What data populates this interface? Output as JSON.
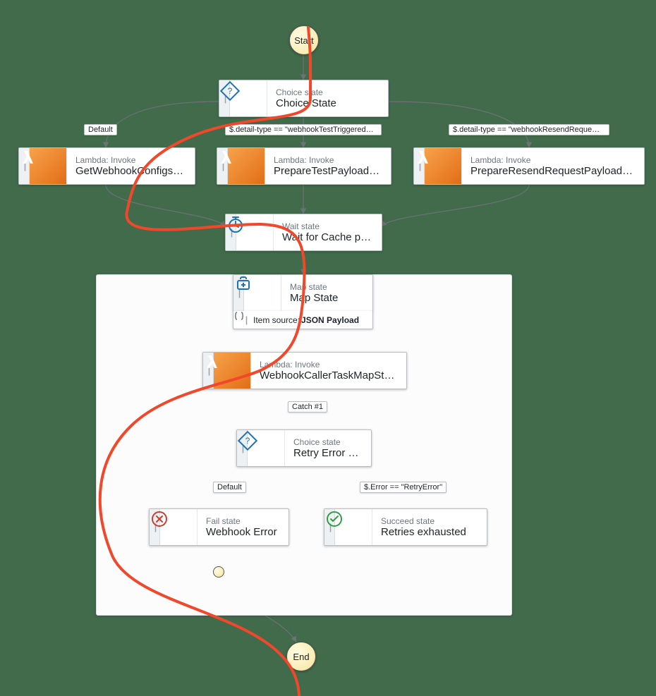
{
  "start": {
    "label": "Start"
  },
  "end": {
    "label": "End"
  },
  "choice_state": {
    "kicker": "Choice state",
    "title": "Choice State"
  },
  "get_configs": {
    "kicker": "Lambda: Invoke",
    "title": "GetWebhookConfigsTask"
  },
  "prepare_test": {
    "kicker": "Lambda: Invoke",
    "title": "PrepareTestPayloadTask"
  },
  "prepare_resend": {
    "kicker": "Lambda: Invoke",
    "title": "PrepareResendRequestPayloadTask"
  },
  "wait_state": {
    "kicker": "Wait state",
    "title": "Wait for Cache purge"
  },
  "map_state": {
    "kicker": "Map state",
    "title": "Map State",
    "item_source_prefix": "Item source: ",
    "item_source_value": "JSON Payload"
  },
  "webhook_caller": {
    "kicker": "Lambda: Invoke",
    "title": "WebhookCallerTaskMapState"
  },
  "retry_choice": {
    "kicker": "Choice state",
    "title": "Retry Error Catch"
  },
  "webhook_error": {
    "kicker": "Fail state",
    "title": "Webhook Error"
  },
  "retries_exh": {
    "kicker": "Succeed state",
    "title": "Retries exhausted"
  },
  "edge_labels": {
    "default1": "Default",
    "test_triggered": "$.detail-type == \"webhookTestTriggered…",
    "resend_request": "$.detail-type == \"webhookResendReque…",
    "catch1": "Catch #1",
    "default2": "Default",
    "retry_error": "$.Error == \"RetryError\""
  }
}
